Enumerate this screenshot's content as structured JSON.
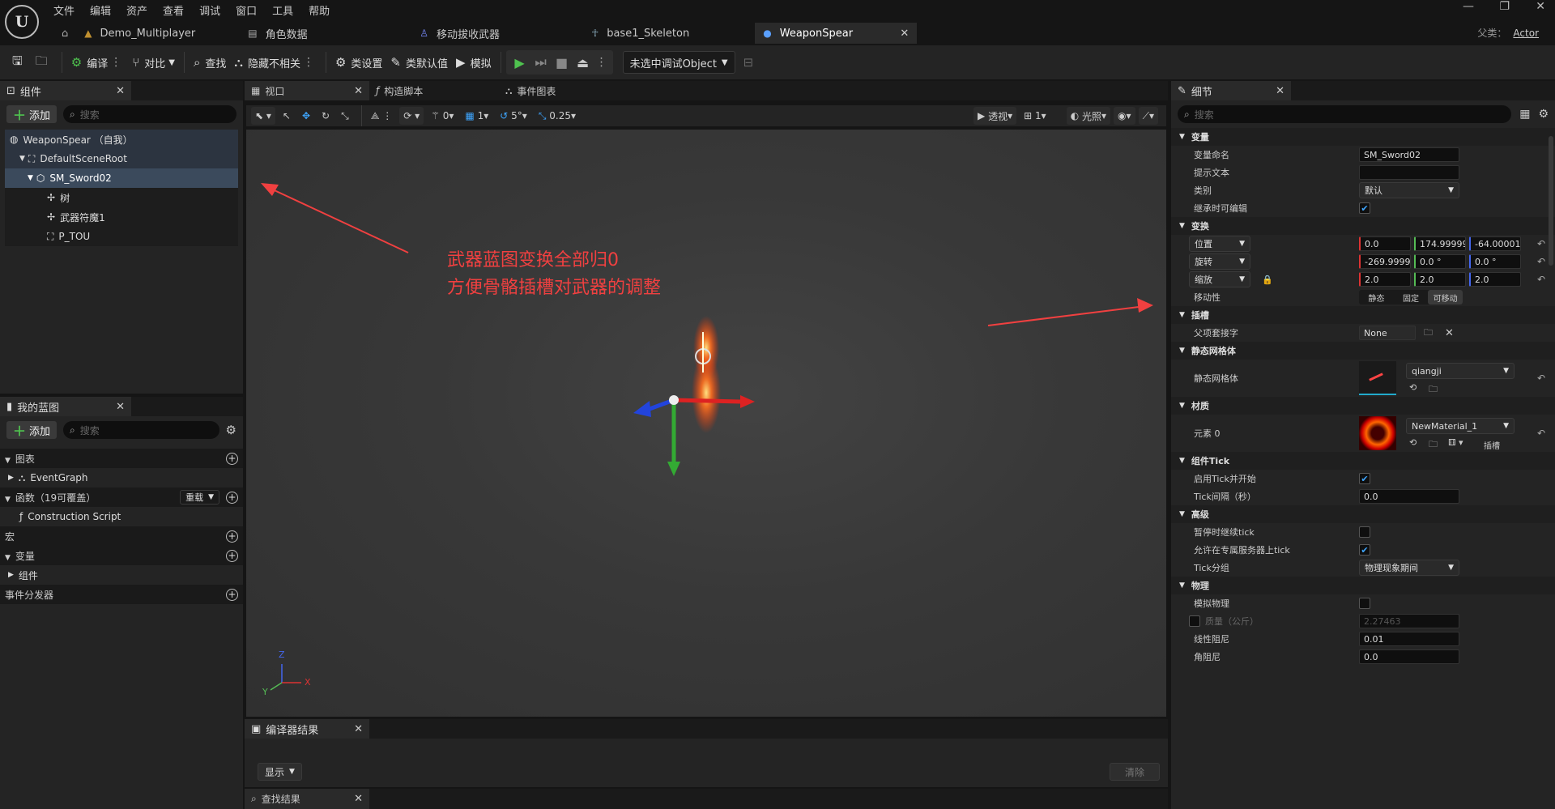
{
  "menu": [
    "文件",
    "编辑",
    "资产",
    "查看",
    "调试",
    "窗口",
    "工具",
    "帮助"
  ],
  "doc_tabs": [
    {
      "label": "Demo_Multiplayer",
      "icon": "level-icon"
    },
    {
      "label": "角色数据",
      "icon": "data-asset-icon"
    },
    {
      "label": "移动拔收武器",
      "icon": "animation-icon"
    },
    {
      "label": "base1_Skeleton",
      "icon": "skeleton-icon"
    },
    {
      "label": "WeaponSpear",
      "icon": "blueprint-icon",
      "active": true
    }
  ],
  "parent_class": {
    "label": "父类：",
    "value": "Actor"
  },
  "toolbar": {
    "compile": "编译",
    "diff": "对比",
    "find": "查找",
    "hide_unrelated": "隐藏不相关",
    "class_settings": "类设置",
    "class_defaults": "类默认值",
    "simulate": "模拟",
    "debug_object": "未选中调试Object"
  },
  "components_panel": {
    "title": "组件",
    "add": "添加",
    "search_placeholder": "搜索",
    "items": [
      {
        "label": "WeaponSpear （自我）",
        "indent": 0
      },
      {
        "label": "DefaultSceneRoot",
        "indent": 1
      },
      {
        "label": "SM_Sword02",
        "indent": 2,
        "selected": true
      },
      {
        "label": "树",
        "indent": 3
      },
      {
        "label": "武器符魔1",
        "indent": 3
      },
      {
        "label": "P_TOU",
        "indent": 3
      }
    ]
  },
  "my_blueprint": {
    "title": "我的蓝图",
    "add": "添加",
    "search_placeholder": "搜索",
    "graphs": "图表",
    "event_graph": "EventGraph",
    "functions": "函数（19可覆盖）",
    "override": "重载",
    "construction_script": "Construction Script",
    "macros": "宏",
    "variables": "变量",
    "components": "组件",
    "event_dispatchers": "事件分发器"
  },
  "editor_tabs": {
    "viewport": "视口",
    "construction": "构造脚本",
    "event_graph": "事件图表"
  },
  "viewport_toolbar": {
    "rot_snap": "0",
    "grid": "1",
    "angle": "5°",
    "scale": "0.25",
    "perspective": "透视",
    "cam_speed": "1",
    "lit": "光照"
  },
  "annotation": {
    "line1": "武器蓝图变换全部归0",
    "line2": "方便骨骼插槽对武器的调整"
  },
  "axis": {
    "z": "Z",
    "y": "Y",
    "x": "X"
  },
  "compiler": {
    "title": "编译器结果",
    "show": "显示",
    "clear": "清除"
  },
  "find_results": {
    "title": "查找结果"
  },
  "details": {
    "title": "细节",
    "search_placeholder": "搜索",
    "sec_variable": "变量",
    "var_name_label": "变量命名",
    "var_name": "SM_Sword02",
    "tooltip_label": "提示文本",
    "tooltip": "",
    "category_label": "类别",
    "category": "默认",
    "editable_label": "继承时可编辑",
    "sec_transform": "变换",
    "location": "位置",
    "loc": [
      "0.0",
      "174.99999",
      "-64.00001"
    ],
    "rotation": "旋转",
    "rot": [
      "-269.99999",
      "0.0 °",
      "0.0 °"
    ],
    "scale": "缩放",
    "scl": [
      "2.0",
      "2.0",
      "2.0"
    ],
    "mobility_label": "移动性",
    "mobility": [
      "静态",
      "固定",
      "可移动"
    ],
    "sec_socket": "插槽",
    "parent_socket_label": "父项套接字",
    "parent_socket": "None",
    "sec_static_mesh": "静态网格体",
    "static_mesh_label": "静态网格体",
    "static_mesh": "qiangji",
    "sec_materials": "材质",
    "element0_label": "元素 0",
    "material": "NewMaterial_1",
    "slot": "插槽",
    "sec_tick": "组件Tick",
    "start_tick_label": "启用Tick并开始",
    "tick_interval_label": "Tick间隔（秒）",
    "tick_interval": "0.0",
    "sec_advanced": "高级",
    "tick_paused_label": "暂停时继续tick",
    "dedicated_label": "允许在专属服务器上tick",
    "tick_group_label": "Tick分组",
    "tick_group": "物理现象期间",
    "sec_physics": "物理",
    "simulate_label": "模拟物理",
    "mass_label": "质量（公斤）",
    "mass": "2.27463",
    "linear_damping_label": "线性阻尼",
    "linear_damping": "0.01",
    "angular_damping_label": "角阻尼",
    "angular_damping": "0.0"
  },
  "colors": {
    "accent": "#3ea6ff",
    "annotation": "#f04040",
    "selection": "#3b4a5c"
  }
}
